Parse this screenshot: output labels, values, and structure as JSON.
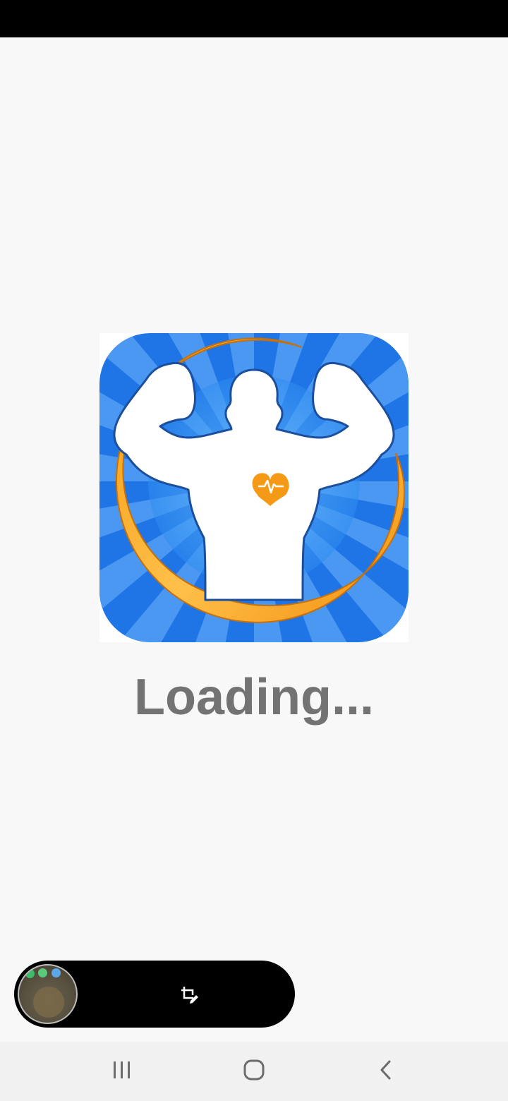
{
  "splash": {
    "loading_text": "Loading..."
  },
  "icons": {
    "app_logo": "fitness-bodybuilder-heart-logo",
    "recent_apps": "recent-apps-icon",
    "home": "home-icon",
    "back": "back-icon",
    "crop_edit": "crop-edit-icon"
  },
  "colors": {
    "background": "#f8f8f8",
    "status_bar": "#000000",
    "logo_blue": "#2f86ee",
    "logo_orange": "#f59a16",
    "loading_text": "#737373",
    "nav_bar": "#f1f1f1"
  }
}
